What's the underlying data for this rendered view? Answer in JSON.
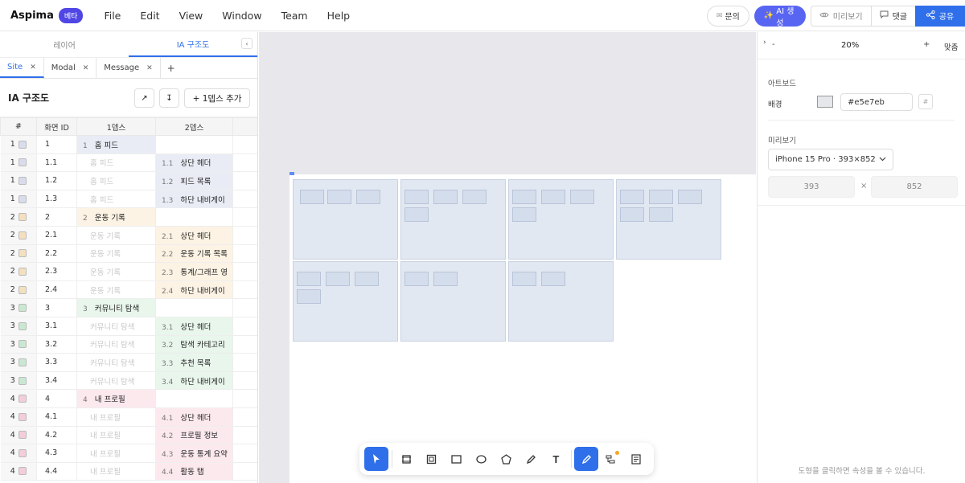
{
  "app": {
    "name": "Aspima",
    "badge": "베타"
  },
  "menu": [
    "File",
    "Edit",
    "View",
    "Window",
    "Team",
    "Help"
  ],
  "topright": {
    "inquiry": "문의",
    "ai": "AI 생성",
    "preview": "미리보기",
    "comment": "댓글",
    "share": "공유"
  },
  "left": {
    "tabs": [
      "레이어",
      "IA 구조도"
    ],
    "active_tab": "IA 구조도",
    "collapse_icon": "chevron-left-icon",
    "sheet_tabs": [
      "Site",
      "Modal",
      "Message"
    ],
    "title": "IA 구조도",
    "add_depth": "+ 1뎁스 추가",
    "columns": [
      "#",
      "화면 ID",
      "1뎁스",
      "2뎁스"
    ],
    "rows": [
      {
        "n": "1",
        "id": "1",
        "d1n": "1",
        "d1": "홈 피드",
        "d2n": "",
        "d2": "",
        "g": false,
        "color": "#e9ecf5",
        "cb": "#d8dced"
      },
      {
        "n": "1",
        "id": "1.1",
        "d1n": "",
        "d1": "홈 피드",
        "d2n": "1.1",
        "d2": "상단 헤더",
        "g": true,
        "color": "#e9ecf5",
        "cb": "#d8dced"
      },
      {
        "n": "1",
        "id": "1.2",
        "d1n": "",
        "d1": "홈 피드",
        "d2n": "1.2",
        "d2": "피드 목록",
        "g": true,
        "color": "#e9ecf5",
        "cb": "#d8dced"
      },
      {
        "n": "1",
        "id": "1.3",
        "d1n": "",
        "d1": "홈 피드",
        "d2n": "1.3",
        "d2": "하단 내비게이",
        "g": true,
        "color": "#e9ecf5",
        "cb": "#d8dced"
      },
      {
        "n": "2",
        "id": "2",
        "d1n": "2",
        "d1": "운동 기록",
        "d2n": "",
        "d2": "",
        "g": false,
        "color": "#fdf3e4",
        "cb": "#f4e0be"
      },
      {
        "n": "2",
        "id": "2.1",
        "d1n": "",
        "d1": "운동 기록",
        "d2n": "2.1",
        "d2": "상단 헤더",
        "g": true,
        "color": "#fdf3e4",
        "cb": "#f4e0be"
      },
      {
        "n": "2",
        "id": "2.2",
        "d1n": "",
        "d1": "운동 기록",
        "d2n": "2.2",
        "d2": "운동 기록 목록",
        "g": true,
        "color": "#fdf3e4",
        "cb": "#f4e0be"
      },
      {
        "n": "2",
        "id": "2.3",
        "d1n": "",
        "d1": "운동 기록",
        "d2n": "2.3",
        "d2": "통계/그래프 영",
        "g": true,
        "color": "#fdf3e4",
        "cb": "#f4e0be"
      },
      {
        "n": "2",
        "id": "2.4",
        "d1n": "",
        "d1": "운동 기록",
        "d2n": "2.4",
        "d2": "하단 내비게이",
        "g": true,
        "color": "#fdf3e4",
        "cb": "#f4e0be"
      },
      {
        "n": "3",
        "id": "3",
        "d1n": "3",
        "d1": "커뮤니티 탐색",
        "d2n": "",
        "d2": "",
        "g": false,
        "color": "#e8f6ec",
        "cb": "#c9e8d2"
      },
      {
        "n": "3",
        "id": "3.1",
        "d1n": "",
        "d1": "커뮤니티 탐색",
        "d2n": "3.1",
        "d2": "상단 헤더",
        "g": true,
        "color": "#e8f6ec",
        "cb": "#c9e8d2"
      },
      {
        "n": "3",
        "id": "3.2",
        "d1n": "",
        "d1": "커뮤니티 탐색",
        "d2n": "3.2",
        "d2": "탐색 카테고리",
        "g": true,
        "color": "#e8f6ec",
        "cb": "#c9e8d2"
      },
      {
        "n": "3",
        "id": "3.3",
        "d1n": "",
        "d1": "커뮤니티 탐색",
        "d2n": "3.3",
        "d2": "추천 목록",
        "g": true,
        "color": "#e8f6ec",
        "cb": "#c9e8d2"
      },
      {
        "n": "3",
        "id": "3.4",
        "d1n": "",
        "d1": "커뮤니티 탐색",
        "d2n": "3.4",
        "d2": "하단 내비게이",
        "g": true,
        "color": "#e8f6ec",
        "cb": "#c9e8d2"
      },
      {
        "n": "4",
        "id": "4",
        "d1n": "4",
        "d1": "내 프로필",
        "d2n": "",
        "d2": "",
        "g": false,
        "color": "#fce9ee",
        "cb": "#f3cdd8"
      },
      {
        "n": "4",
        "id": "4.1",
        "d1n": "",
        "d1": "내 프로필",
        "d2n": "4.1",
        "d2": "상단 헤더",
        "g": true,
        "color": "#fce9ee",
        "cb": "#f3cdd8"
      },
      {
        "n": "4",
        "id": "4.2",
        "d1n": "",
        "d1": "내 프로필",
        "d2n": "4.2",
        "d2": "프로필 정보",
        "g": true,
        "color": "#fce9ee",
        "cb": "#f3cdd8"
      },
      {
        "n": "4",
        "id": "4.3",
        "d1n": "",
        "d1": "내 프로필",
        "d2n": "4.3",
        "d2": "운동 통계 요약",
        "g": true,
        "color": "#fce9ee",
        "cb": "#f3cdd8"
      },
      {
        "n": "4",
        "id": "4.4",
        "d1n": "",
        "d1": "내 프로필",
        "d2n": "4.4",
        "d2": "활동 탭",
        "g": true,
        "color": "#fce9ee",
        "cb": "#f3cdd8"
      }
    ]
  },
  "right": {
    "zoom": "20%",
    "fit": "맞춤",
    "zoom_out": "-",
    "zoom_in": "+",
    "artboard_section": "아트보드",
    "bg_label": "배경",
    "bg_value": "#e5e7eb",
    "preview_section": "미리보기",
    "device": "iPhone 15 Pro · 393×852",
    "width": "393",
    "height": "852",
    "times": "×",
    "hint": "도형을 클릭하면 속성을 볼 수 있습니다."
  },
  "tools": [
    "select-arrow-icon",
    "frame-icon",
    "component-icon",
    "rectangle-icon",
    "ellipse-icon",
    "polygon-icon",
    "pen-icon",
    "text-icon",
    "brush-icon",
    "flow-icon",
    "notes-icon"
  ]
}
